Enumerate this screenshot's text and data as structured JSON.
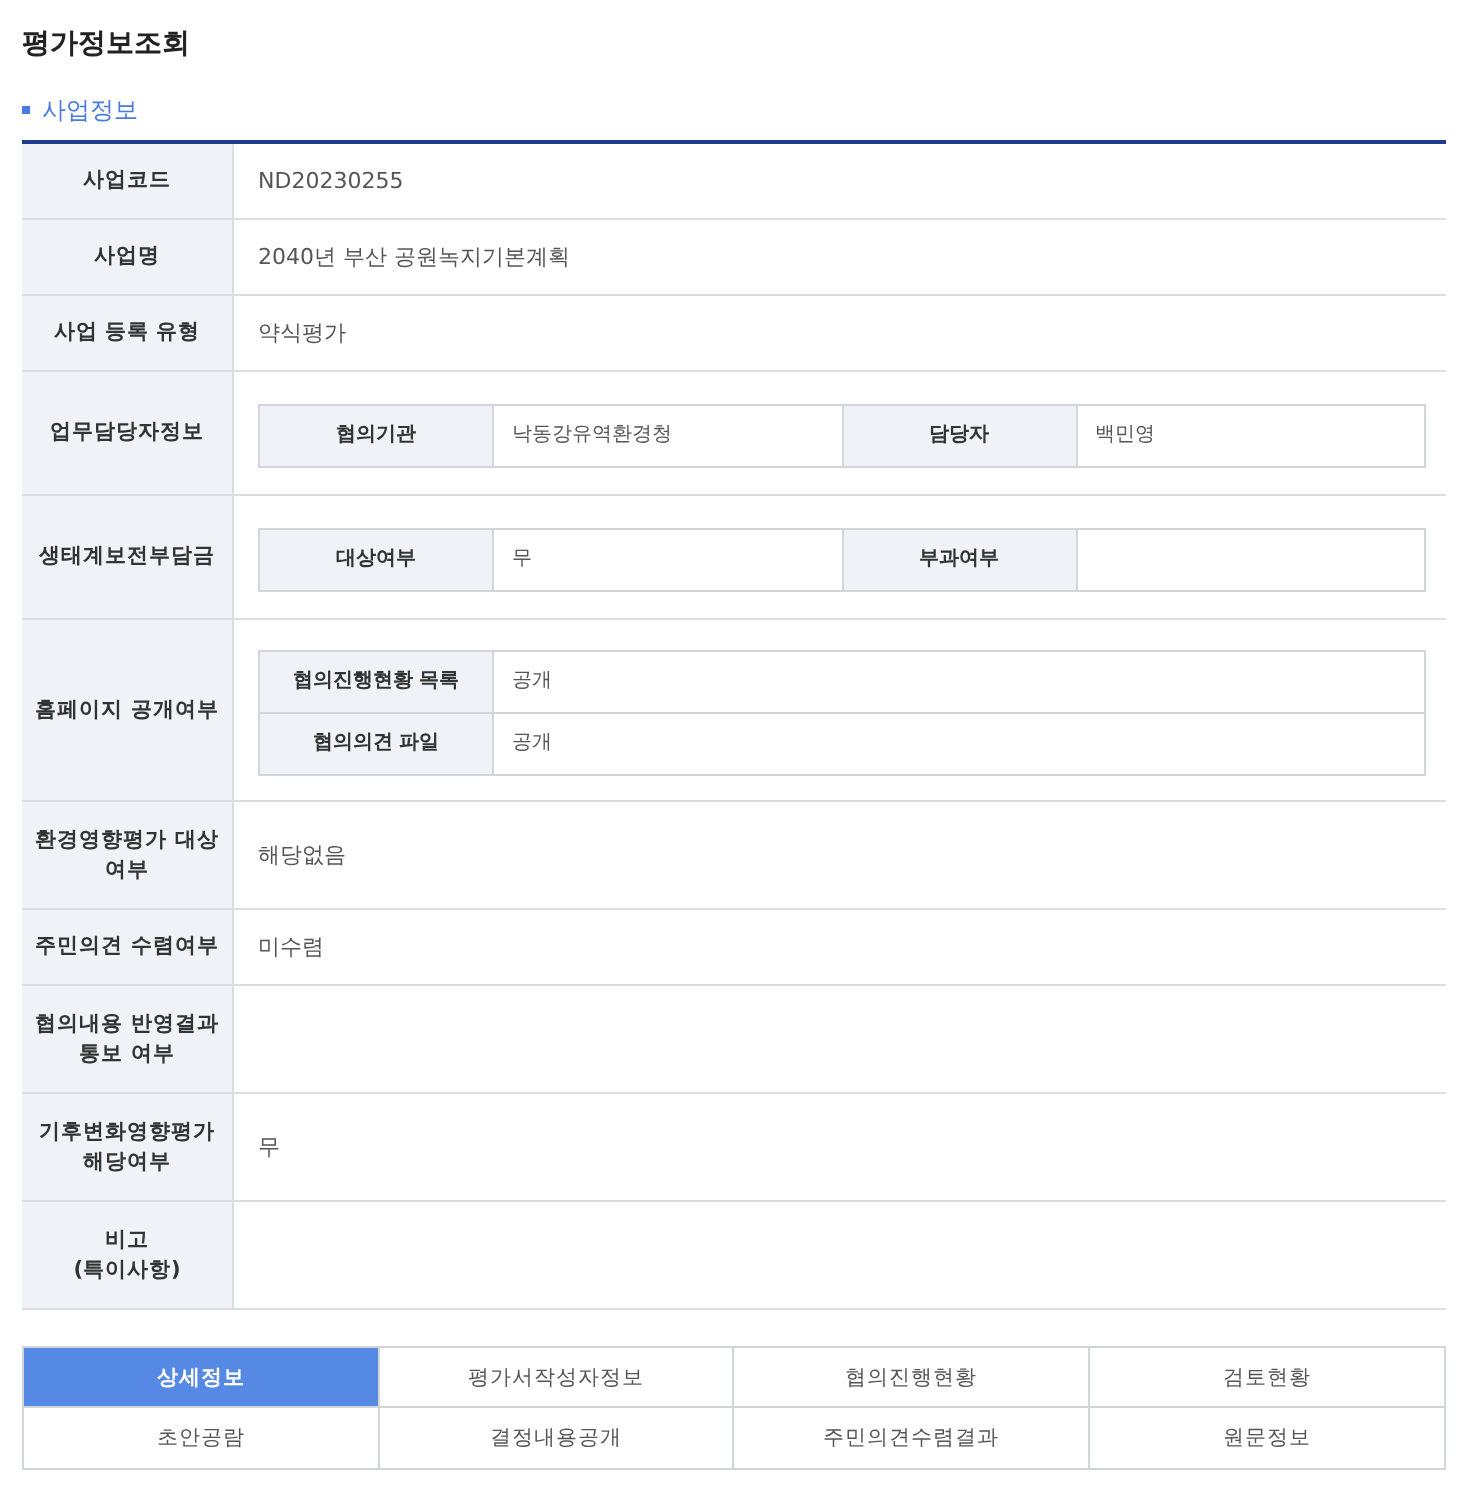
{
  "title": "평가정보조회",
  "section": {
    "title": "사업정보"
  },
  "rows": [
    {
      "label": "사업코드",
      "kind": "text",
      "value": "ND20230255"
    },
    {
      "label": "사업명",
      "kind": "text",
      "value": "2040년 부산 공원녹지기본계획"
    },
    {
      "label": "사업 등록 유형",
      "kind": "text",
      "value": "약식평가"
    },
    {
      "label": "업무담당자정보",
      "kind": "grid",
      "grid": [
        [
          {
            "label": "협의기관",
            "value": "낙동강유역환경청"
          },
          {
            "label": "담당자",
            "value": "백민영"
          }
        ]
      ]
    },
    {
      "label": "생태계보전부담금",
      "kind": "grid",
      "grid": [
        [
          {
            "label": "대상여부",
            "value": "무"
          },
          {
            "label": "부과여부"
          }
        ]
      ]
    },
    {
      "label": "홈페이지 공개여부",
      "kind": "grid",
      "grid": [
        [
          {
            "label": "협의진행현황 목록",
            "value": "공개"
          }
        ],
        [
          {
            "label": "협의의견 파일",
            "value": "공개"
          }
        ]
      ]
    },
    {
      "label": "환경영향평가 대상\n여부",
      "kind": "text",
      "value": "해당없음"
    },
    {
      "label": "주민의견 수렴여부",
      "kind": "text",
      "value": "미수렴"
    },
    {
      "label": "협의내용 반영결과\n통보 여부",
      "kind": "text"
    },
    {
      "label": "기후변화영향평가\n해당여부",
      "kind": "text",
      "value": "무"
    },
    {
      "label": "비고\n(특이사항)",
      "kind": "text"
    }
  ],
  "tabs": [
    {
      "label": "상세정보",
      "selected": true
    },
    {
      "label": "평가서작성자정보",
      "selected": false
    },
    {
      "label": "협의진행현황",
      "selected": false
    },
    {
      "label": "검토현황",
      "selected": false
    },
    {
      "label": "초안공람",
      "selected": false
    },
    {
      "label": "결정내용공개",
      "selected": false
    },
    {
      "label": "주민의견수렴결과",
      "selected": false
    },
    {
      "label": "원문정보",
      "selected": false
    }
  ]
}
